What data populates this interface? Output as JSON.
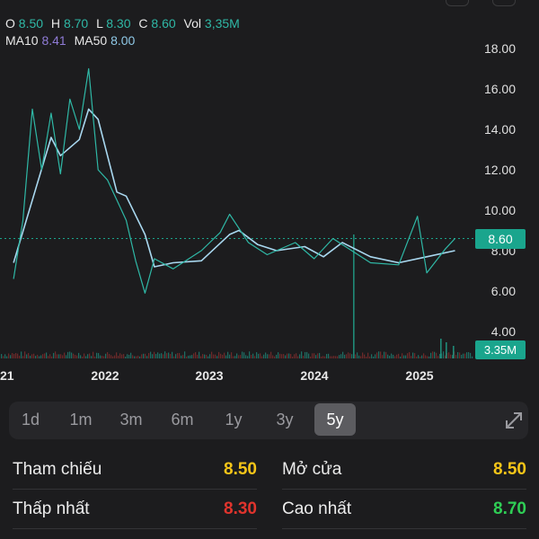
{
  "header": {
    "o_label": "O",
    "o_value": "8.50",
    "h_label": "H",
    "h_value": "8.70",
    "l_label": "L",
    "l_value": "8.30",
    "c_label": "C",
    "c_value": "8.60",
    "vol_label": "Vol",
    "vol_value": "3,35M",
    "ma10_label": "MA10",
    "ma10_value": "8.41",
    "ma50_label": "MA50",
    "ma50_value": "8.00"
  },
  "chart_data": {
    "type": "line",
    "y_axis_ticks": [
      "18.00",
      "16.00",
      "14.00",
      "12.00",
      "10.00",
      "8.00",
      "6.00",
      "4.00"
    ],
    "ylim": [
      3.6,
      18.6
    ],
    "x_axis_ticks": [
      "21",
      "2022",
      "2023",
      "2024",
      "2025"
    ],
    "current_price": "8.60",
    "current_volume": "3.35M",
    "series": [
      {
        "name": "MA50",
        "color": "#a9d8f0",
        "points": [
          [
            "2021-07",
            7.4
          ],
          [
            "2021-09",
            10.5
          ],
          [
            "2021-11",
            13.6
          ],
          [
            "2021-12",
            12.7
          ],
          [
            "2022-02",
            13.5
          ],
          [
            "2022-03",
            15.0
          ],
          [
            "2022-04",
            14.5
          ],
          [
            "2022-06",
            10.9
          ],
          [
            "2022-07",
            10.7
          ],
          [
            "2022-09",
            8.8
          ],
          [
            "2022-10",
            7.2
          ],
          [
            "2022-12",
            7.4
          ],
          [
            "2023-03",
            7.5
          ],
          [
            "2023-06",
            8.8
          ],
          [
            "2023-07",
            9.0
          ],
          [
            "2023-09",
            8.3
          ],
          [
            "2023-11",
            8.0
          ],
          [
            "2024-02",
            8.2
          ],
          [
            "2024-04",
            7.7
          ],
          [
            "2024-06",
            8.4
          ],
          [
            "2024-09",
            7.7
          ],
          [
            "2024-12",
            7.4
          ],
          [
            "2025-03",
            7.7
          ],
          [
            "2025-06",
            8.0
          ]
        ]
      },
      {
        "name": "Price",
        "color": "#2fb8a6",
        "points": [
          [
            "2021-07",
            6.6
          ],
          [
            "2021-08",
            9.5
          ],
          [
            "2021-09",
            15.0
          ],
          [
            "2021-10",
            12.0
          ],
          [
            "2021-11",
            14.8
          ],
          [
            "2021-12",
            11.8
          ],
          [
            "2022-01",
            15.5
          ],
          [
            "2022-02",
            14.0
          ],
          [
            "2022-03",
            17.0
          ],
          [
            "2022-04",
            12.0
          ],
          [
            "2022-05",
            11.5
          ],
          [
            "2022-06",
            10.5
          ],
          [
            "2022-07",
            9.5
          ],
          [
            "2022-08",
            7.5
          ],
          [
            "2022-09",
            5.9
          ],
          [
            "2022-10",
            7.6
          ],
          [
            "2022-12",
            7.1
          ],
          [
            "2023-03",
            8.0
          ],
          [
            "2023-05",
            8.9
          ],
          [
            "2023-06",
            9.8
          ],
          [
            "2023-08",
            8.4
          ],
          [
            "2023-10",
            7.8
          ],
          [
            "2024-01",
            8.4
          ],
          [
            "2024-03",
            7.6
          ],
          [
            "2024-05",
            8.6
          ],
          [
            "2024-07",
            8.0
          ],
          [
            "2024-09",
            7.4
          ],
          [
            "2024-12",
            7.3
          ],
          [
            "2025-02",
            9.7
          ],
          [
            "2025-03",
            6.9
          ],
          [
            "2025-05",
            8.1
          ],
          [
            "2025-06",
            8.6
          ]
        ]
      }
    ]
  },
  "range_tabs": [
    "1d",
    "1m",
    "3m",
    "6m",
    "1y",
    "3y",
    "5y"
  ],
  "active_range": "5y",
  "stats": {
    "ref_label": "Tham chiếu",
    "ref_value": "8.50",
    "open_label": "Mở cửa",
    "open_value": "8.50",
    "low_label": "Thấp nhất",
    "low_value": "8.30",
    "high_label": "Cao nhất",
    "high_value": "8.70"
  },
  "colors": {
    "yellow": "#f5c518",
    "red": "#e0342d",
    "green": "#2fce55",
    "teal": "#1aa58d"
  }
}
